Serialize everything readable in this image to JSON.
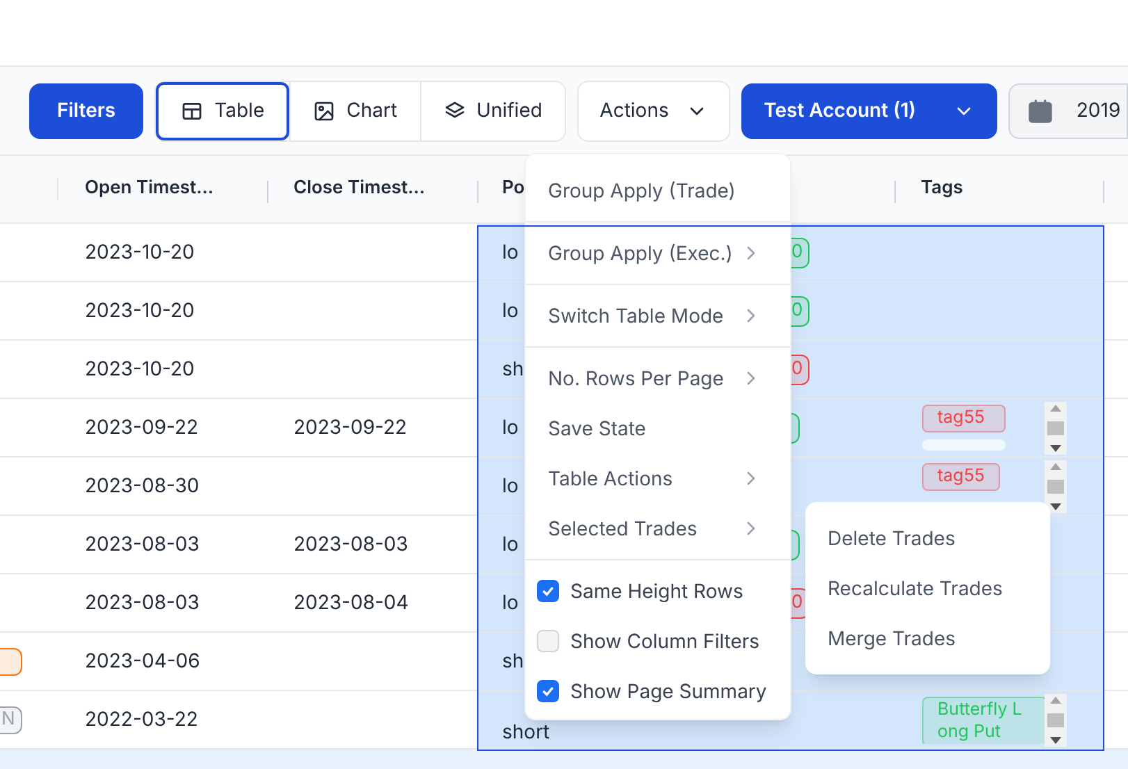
{
  "toolbar": {
    "filters": "Filters",
    "views": [
      {
        "label": "Table",
        "kind": "table",
        "selected": true
      },
      {
        "label": "Chart",
        "kind": "image",
        "selected": false
      },
      {
        "label": "Unified",
        "kind": "layers",
        "selected": false
      }
    ],
    "actions": "Actions",
    "account": "Test Account (1)",
    "date": "2019"
  },
  "table": {
    "columns": [
      {
        "label": "Open Timest…"
      },
      {
        "label": "Close Timest…"
      },
      {
        "label": "Po"
      },
      {
        "label": "Tags"
      }
    ],
    "rows": [
      {
        "open": "2023-10-20",
        "position": "lo",
        "pnl_badge": {
          "text": "0",
          "color": "#22c55e"
        },
        "selected": true
      },
      {
        "open": "2023-10-20",
        "position": "lo",
        "pnl_badge": {
          "text": "0",
          "color": "#22c55e"
        },
        "selected": true
      },
      {
        "open": "2023-10-20",
        "position": "sh",
        "pnl_badge": {
          "text": "0",
          "color": "#ef4444"
        },
        "selected": true
      },
      {
        "open": "2023-09-22",
        "close": "2023-09-22",
        "position": "lo",
        "pnl_badge": {
          "color": "#22c55e"
        },
        "tags": [
          {
            "text": "tag55",
            "color": "#ef4444"
          },
          {
            "color": "#f1f7ff"
          }
        ],
        "selected": true
      },
      {
        "open": "2023-08-30",
        "position": "lo",
        "tags": [
          {
            "text": "tag55",
            "color": "#ef4444"
          }
        ],
        "selected": true
      },
      {
        "open": "2023-08-03",
        "close": "2023-08-03",
        "position": "lo",
        "pnl_badge": {
          "color": "#22c55e"
        },
        "selected": true
      },
      {
        "open": "2023-08-03",
        "close": "2023-08-04",
        "position": "lo",
        "pnl_badge": {
          "text": "0",
          "color": "#ef4444"
        },
        "selected": true
      },
      {
        "lead_badge": {
          "color": "#f97316"
        },
        "open": "2023-04-06",
        "position": "sh",
        "selected": true
      },
      {
        "lead_badge": {
          "text": "N",
          "color": "#9ca3af"
        },
        "open": "2022-03-22",
        "position": "short",
        "tags": [
          {
            "text": "Butterfly Long Put",
            "color": "#22c55e"
          }
        ],
        "selected": true
      }
    ]
  },
  "actions_menu": {
    "items": [
      {
        "kind": "action",
        "label": "Group Apply (Trade)",
        "submenu": false,
        "divider_after": true
      },
      {
        "kind": "action",
        "label": "Group Apply (Exec.)",
        "submenu": true,
        "divider_after": true
      },
      {
        "kind": "action",
        "label": "Switch Table Mode",
        "submenu": true,
        "divider_after": true
      },
      {
        "kind": "action",
        "label": "No. Rows Per Page",
        "submenu": true,
        "divider_after": false
      },
      {
        "kind": "action",
        "label": "Save State",
        "submenu": false,
        "divider_after": false
      },
      {
        "kind": "action",
        "label": "Table Actions",
        "submenu": true,
        "divider_after": false
      },
      {
        "kind": "action",
        "label": "Selected Trades",
        "submenu": true,
        "divider_after": true
      },
      {
        "kind": "checkbox",
        "label": "Same Height Rows",
        "checked": true
      },
      {
        "kind": "checkbox",
        "label": "Show Column Filters",
        "checked": false
      },
      {
        "kind": "checkbox",
        "label": "Show Page Summary",
        "checked": true
      }
    ]
  },
  "submenu": {
    "items": [
      "Delete Trades",
      "Recalculate Trades",
      "Merge Trades"
    ]
  }
}
